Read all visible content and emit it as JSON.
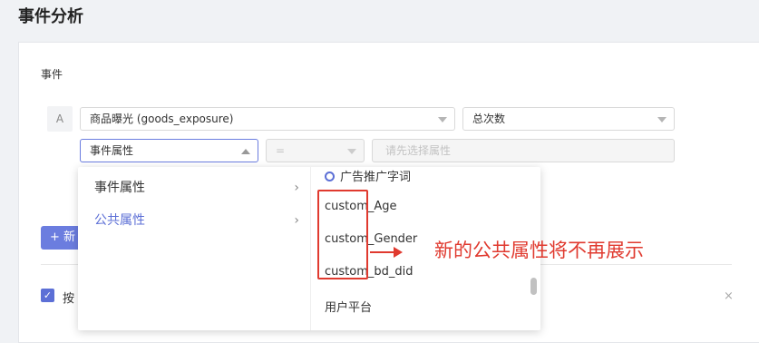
{
  "page": {
    "title": "事件分析"
  },
  "event_section": {
    "label": "事件",
    "row_badge": "A",
    "event_select": {
      "value": "商品曝光 (goods_exposure)"
    },
    "metric_select": {
      "value": "总次数"
    },
    "property_select": {
      "value": "事件属性"
    },
    "operator_select": {
      "value": "="
    },
    "value_select": {
      "placeholder": "请先选择属性"
    }
  },
  "new_button": {
    "icon": "+",
    "label": "新"
  },
  "checkbox": {
    "checked": true,
    "label": "按"
  },
  "close_icon": "×",
  "dropdown": {
    "categories": [
      {
        "label": "事件属性",
        "chevron": "›"
      },
      {
        "label": "公共属性",
        "chevron": "›"
      }
    ],
    "options": [
      {
        "label": "广告推广字词",
        "icon": "search-icon"
      },
      {
        "label": "custom_Age"
      },
      {
        "label": "custom_Gender"
      },
      {
        "label": "custom_bd_did"
      },
      {
        "label": "用户平台"
      }
    ]
  },
  "annotation": {
    "text": "新的公共属性将不再展示",
    "color": "#e03a2f"
  },
  "colors": {
    "accent": "#5c6fd6",
    "annotation": "#e03a2f"
  }
}
